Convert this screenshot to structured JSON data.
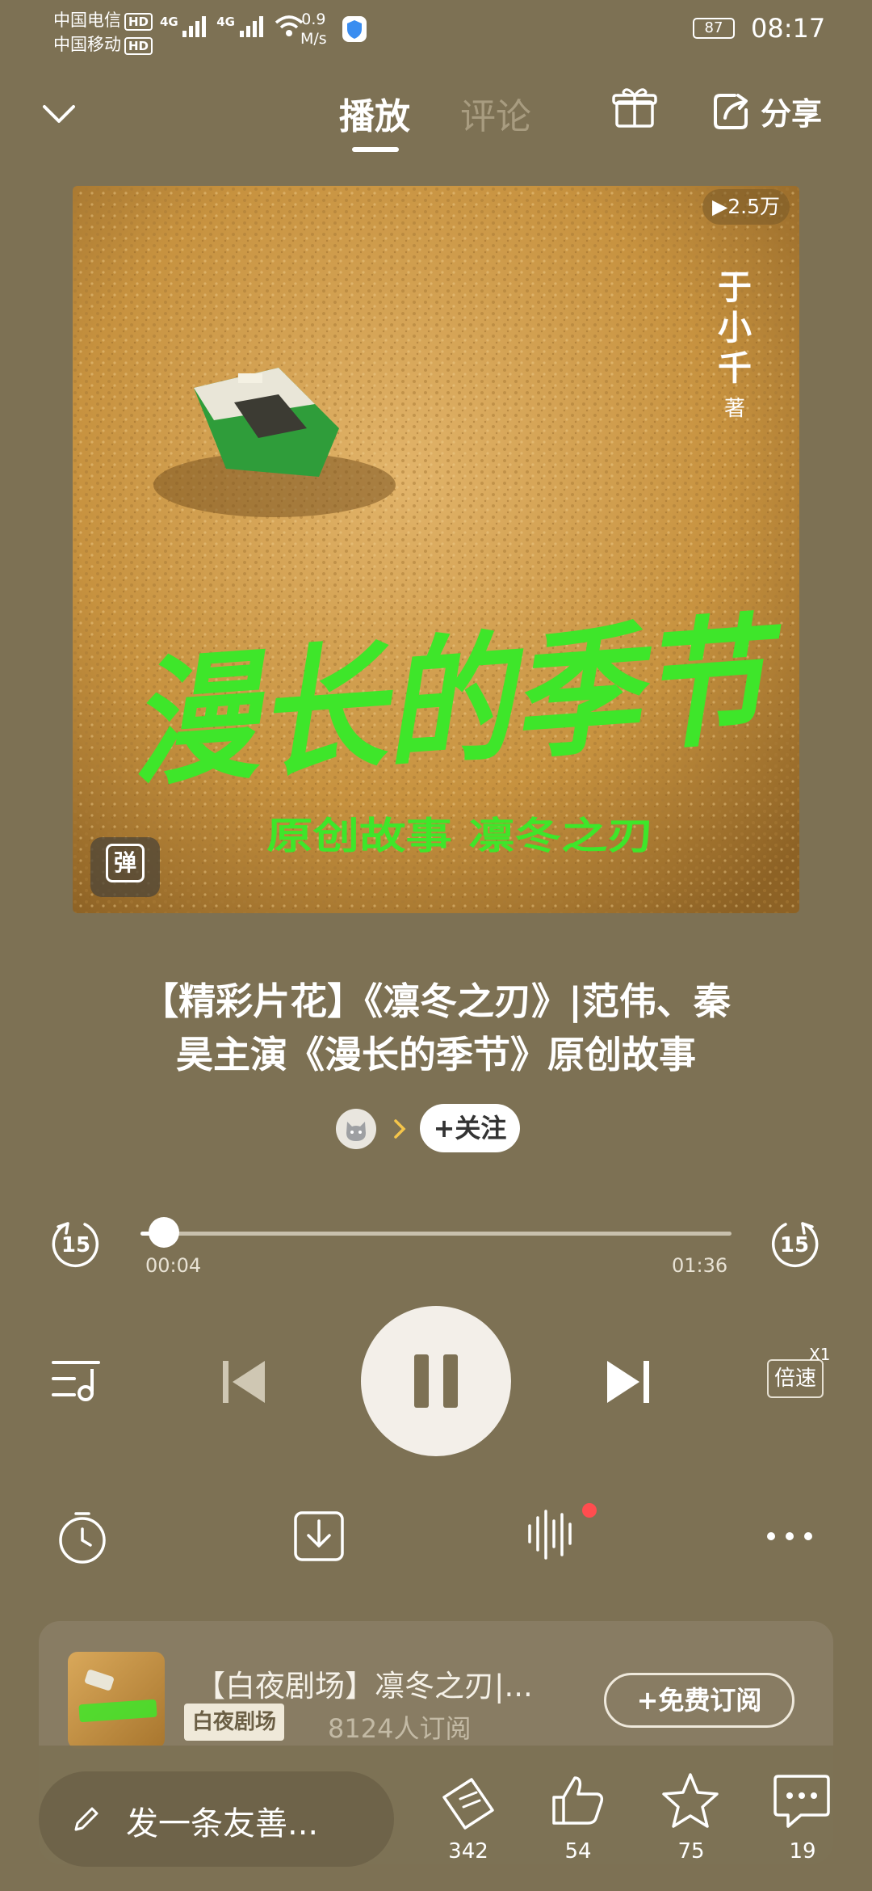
{
  "status_bar": {
    "carrier1": "中国电信",
    "carrier2": "中国移动",
    "hd": "HD",
    "net1": "4G",
    "net2": "4G",
    "speed_value": "0.9",
    "speed_unit": "M/s",
    "battery": "87",
    "time": "08:17"
  },
  "header": {
    "tab_play": "播放",
    "tab_comment": "评论",
    "share_label": "分享"
  },
  "cover": {
    "play_count": "2.5万",
    "author": [
      "于",
      "小",
      "千"
    ],
    "author_suffix": "著",
    "calligraphy_title": "漫长的季节",
    "subtitle": "原创故事 凛冬之刃",
    "danmaku_label": "弹"
  },
  "track": {
    "title_line1": "【精彩片花】《凛冬之刃》|范伟、秦",
    "title_line2": "昊主演《漫长的季节》原创故事",
    "follow_label": "+关注",
    "current_time": "00:04",
    "total_time": "01:36",
    "progress": 0.04,
    "skip_back": "15",
    "skip_forward": "15",
    "speed_label": "倍速",
    "speed_multiplier": "X1"
  },
  "album": {
    "title": "【白夜剧场】凛冬之刃|...",
    "badge": "白夜剧场",
    "subscribers": "8124人订阅",
    "subscribe_label": "+免费订阅"
  },
  "bottom_bar": {
    "comment_placeholder": "发一条友善...",
    "ticket_count": "342",
    "like_count": "54",
    "star_count": "75",
    "comment_count": "19"
  },
  "colors": {
    "background": "#7d7154",
    "accent_green": "#3ee62a",
    "notification_red": "#ff4d4f"
  }
}
